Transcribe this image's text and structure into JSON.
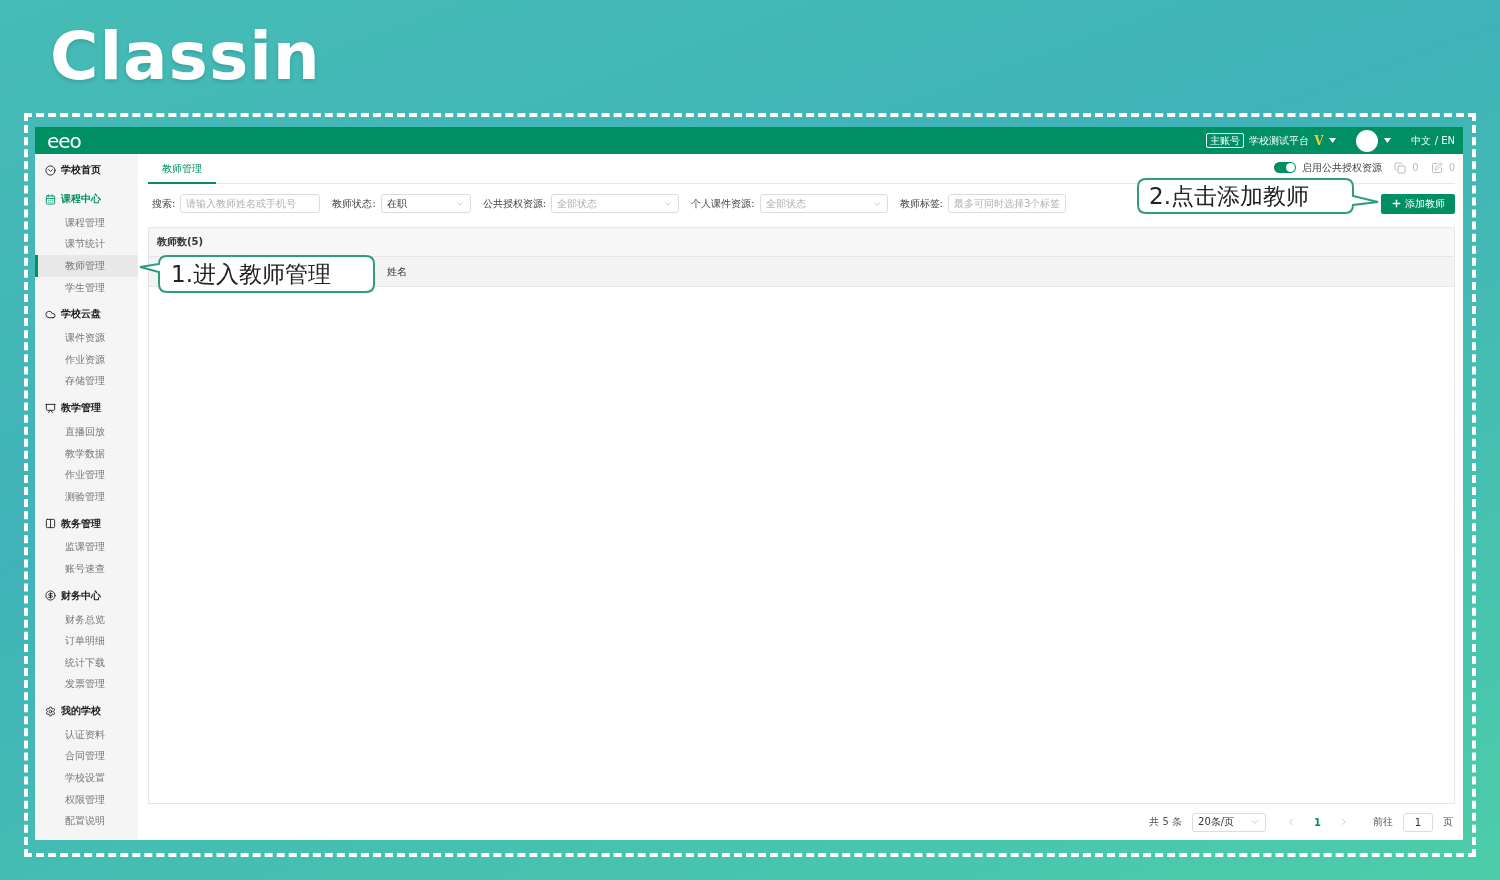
{
  "brand": {
    "logo": "Classin"
  },
  "header": {
    "logo": "eeo",
    "account_badge": "主账号",
    "school": "学校测试平台",
    "vip_mark": "V",
    "language": "中文 / EN"
  },
  "sidebar": {
    "groups": [
      {
        "label": "学校首页",
        "selected": false
      },
      {
        "label": "课程中心",
        "selected": true,
        "children": [
          {
            "label": "课程管理",
            "selected": false
          },
          {
            "label": "课节统计",
            "selected": false
          },
          {
            "label": "教师管理",
            "selected": true
          },
          {
            "label": "学生管理",
            "selected": false
          }
        ]
      },
      {
        "label": "学校云盘",
        "selected": false,
        "children": [
          {
            "label": "课件资源",
            "selected": false
          },
          {
            "label": "作业资源",
            "selected": false
          },
          {
            "label": "存储管理",
            "selected": false
          }
        ]
      },
      {
        "label": "教学管理",
        "selected": false,
        "children": [
          {
            "label": "直播回放",
            "selected": false
          },
          {
            "label": "教学数据",
            "selected": false
          },
          {
            "label": "作业管理",
            "selected": false
          },
          {
            "label": "测验管理",
            "selected": false
          }
        ]
      },
      {
        "label": "教务管理",
        "selected": false,
        "children": [
          {
            "label": "监课管理",
            "selected": false
          },
          {
            "label": "账号速查",
            "selected": false
          }
        ]
      },
      {
        "label": "财务中心",
        "selected": false,
        "children": [
          {
            "label": "财务总览",
            "selected": false
          },
          {
            "label": "订单明细",
            "selected": false
          },
          {
            "label": "统计下载",
            "selected": false
          },
          {
            "label": "发票管理",
            "selected": false
          }
        ]
      },
      {
        "label": "我的学校",
        "selected": false,
        "children": [
          {
            "label": "认证资料",
            "selected": false
          },
          {
            "label": "合同管理",
            "selected": false
          },
          {
            "label": "学校设置",
            "selected": false
          },
          {
            "label": "权限管理",
            "selected": false
          },
          {
            "label": "配置说明",
            "selected": false
          }
        ]
      }
    ]
  },
  "tabs": [
    {
      "label": "教师管理",
      "selected": true
    }
  ],
  "toggle": {
    "label": "启用公共授权资源",
    "on": true
  },
  "counters": [
    {
      "kind": "copy",
      "count": "0"
    },
    {
      "kind": "edit",
      "count": "0"
    }
  ],
  "filters": [
    {
      "label": "搜索:",
      "kind": "input",
      "placeholder": "请输入教师姓名或手机号"
    },
    {
      "label": "教师状态:",
      "kind": "select",
      "value": "在职"
    },
    {
      "label": "公共授权资源:",
      "kind": "select",
      "placeholder": "全部状态"
    },
    {
      "label": "个人课件资源:",
      "kind": "select",
      "placeholder": "全部状态"
    },
    {
      "label": "教师标签:",
      "kind": "input",
      "placeholder": "最多可同时选择3个标签"
    }
  ],
  "add_button": {
    "label": "添加教师"
  },
  "table": {
    "count_label": "教师数(5)",
    "columns": [
      "姓名"
    ]
  },
  "pagination": {
    "total": "共 5 条",
    "page_size": "20条/页",
    "pages": [
      {
        "label": "1",
        "selected": true
      }
    ],
    "goto_label": "前往",
    "goto_value": "1",
    "goto_suffix": "页"
  },
  "callouts": [
    {
      "kind": "left",
      "text": "1.进入教师管理"
    },
    {
      "kind": "right",
      "text": "2.点击添加教师"
    }
  ]
}
